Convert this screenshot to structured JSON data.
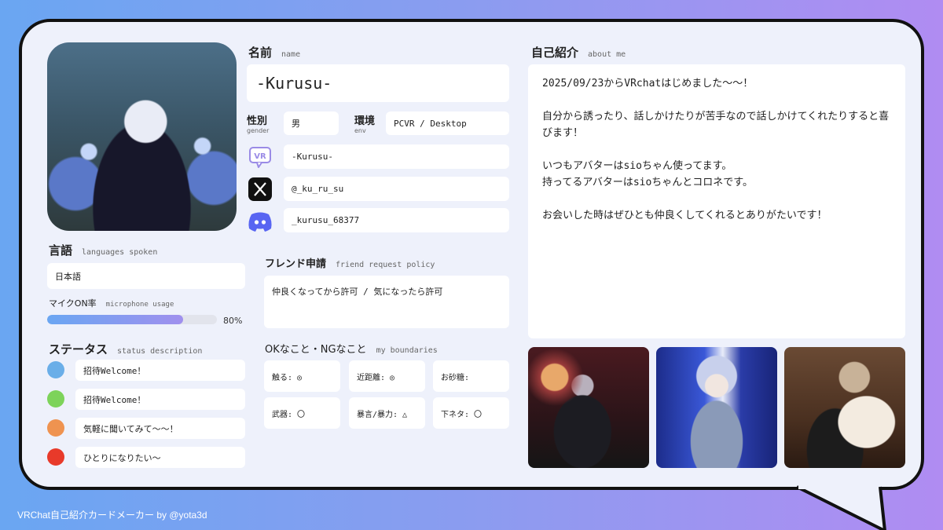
{
  "profile": {
    "name_heading": "名前",
    "name_heading_sub": "name",
    "name": "-Kurusu-",
    "gender_label": "性別",
    "gender_label_sub": "gender",
    "gender": "男",
    "env_label": "環境",
    "env_label_sub": "env",
    "env": "PCVR / Desktop",
    "vrchat_id": "-Kurusu-",
    "x_id": "@_ku_ru_su",
    "discord_id": "_kurusu_68377"
  },
  "languages": {
    "heading": "言語",
    "heading_sub": "languages spoken",
    "value": "日本語"
  },
  "microphone": {
    "heading": "マイクON率",
    "heading_sub": "microphone usage",
    "percent": 80,
    "percent_label": "80%"
  },
  "status": {
    "heading": "ステータス",
    "heading_sub": "status description",
    "items": [
      {
        "color": "#6aaee8",
        "label": "招待Welcome！"
      },
      {
        "color": "#7dd35a",
        "label": "招待Welcome！"
      },
      {
        "color": "#ef9350",
        "label": "気軽に聞いてみて～～！"
      },
      {
        "color": "#e83a2a",
        "label": "ひとりになりたい～"
      }
    ]
  },
  "friend_request": {
    "heading": "フレンド申請",
    "heading_sub": "friend request policy",
    "value": "仲良くなってから許可 / 気になったら許可"
  },
  "boundaries": {
    "heading": "OKなこと・NGなこと",
    "heading_sub": "my boundaries",
    "items": [
      {
        "label": "触る: ◎"
      },
      {
        "label": "近距離: ◎"
      },
      {
        "label": "お砂糖:"
      },
      {
        "label": "武器: 〇"
      },
      {
        "label": "暴言/暴力: △"
      },
      {
        "label": "下ネタ: 〇"
      }
    ]
  },
  "about": {
    "heading": "自己紹介",
    "heading_sub": "about me",
    "paragraphs": [
      "2025/09/23からVRchatはじめました～～！",
      "自分から誘ったり、話しかけたりが苦手なので話しかけてくれたりすると喜びます！",
      "いつもアバターはsioちゃん使ってます。\n持ってるアバターはsioちゃんとコロネです。",
      "お会いした時はぜひとも仲良くしてくれるとありがたいです！"
    ]
  },
  "icons": {
    "vrchat": "vrchat-icon",
    "x": "x-icon",
    "discord": "discord-icon"
  },
  "footer": "VRChat自己紹介カードメーカー by @yota3d"
}
